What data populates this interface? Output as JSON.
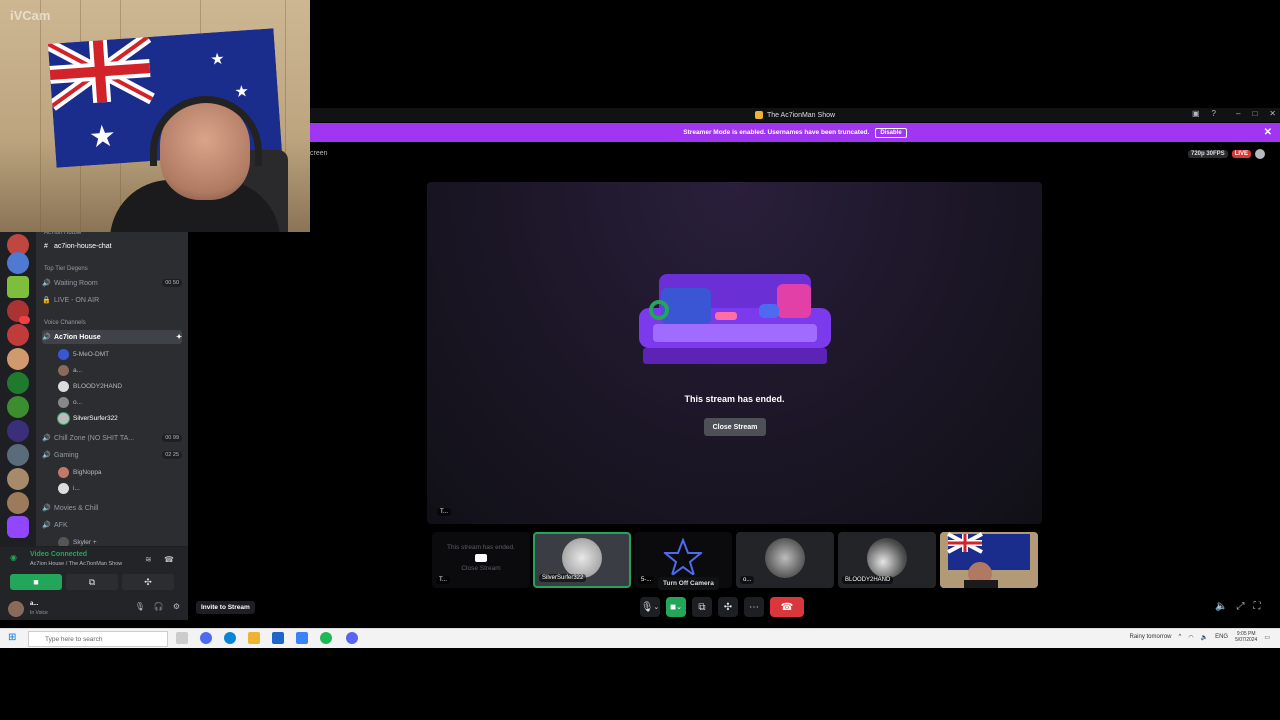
{
  "webcam": {
    "watermark": "iVCam"
  },
  "titlebar": {
    "title": "The Ac7ionMan Show"
  },
  "banner": {
    "message": "Streamer Mode is enabled. Usernames have been truncated.",
    "disable_label": "Disable"
  },
  "header": {
    "crumb": "creen",
    "quality": "720p 30FPS",
    "live": "LIVE"
  },
  "stream": {
    "ended_text": "This stream has ended.",
    "close_label": "Close Stream",
    "tag": "T..."
  },
  "tiles": [
    {
      "ghost_text": "This stream has ended.",
      "ghost_btn": "Close Stream",
      "label": "T..."
    },
    {
      "label": "SilverSurfer322"
    },
    {
      "label": "5-..."
    },
    {
      "label": "o..."
    },
    {
      "label": "BLOODY2HAND"
    },
    {
      "label": ""
    }
  ],
  "tooltip": "Turn Off Camera",
  "invite_label": "Invite to Stream",
  "channels": {
    "top_cut": "Ac7ion House",
    "text_channel": "ac7ion-house-chat",
    "cat1": "Top Tier Degens",
    "waiting": "Waiting Room",
    "waiting_cnt": "00 50",
    "liveair": "LIVE - ON AIR",
    "cat2": "Voice Channels",
    "active": "Ac7ion House",
    "members": [
      "5-MeO-DMT",
      "a...",
      "BLOODY2HAND",
      "o...",
      "SilverSurfer322"
    ],
    "chill": "Chill Zone (NO SHIT TA...",
    "chill_cnt": "00 99",
    "gaming": "Gaming",
    "gaming_cnt": "02 25",
    "gaming_members": [
      "BigNoppa",
      "i..."
    ],
    "movies": "Movies & Chill",
    "afk": "AFK",
    "afk_member": "Skyler +"
  },
  "voice": {
    "title": "Video Connected",
    "sub": "Ac7ion House / The Ac7ionMan Show"
  },
  "user": {
    "name": "a...",
    "status": "In Voice"
  },
  "taskbar": {
    "search": "Type here to search",
    "weather": "Rainy tomorrow",
    "lang": "ENG",
    "time": "9:05 PM",
    "date": "5/07/2024"
  },
  "colors": {
    "accent": "#a136f2",
    "green": "#23a55a",
    "red": "#da373c"
  }
}
